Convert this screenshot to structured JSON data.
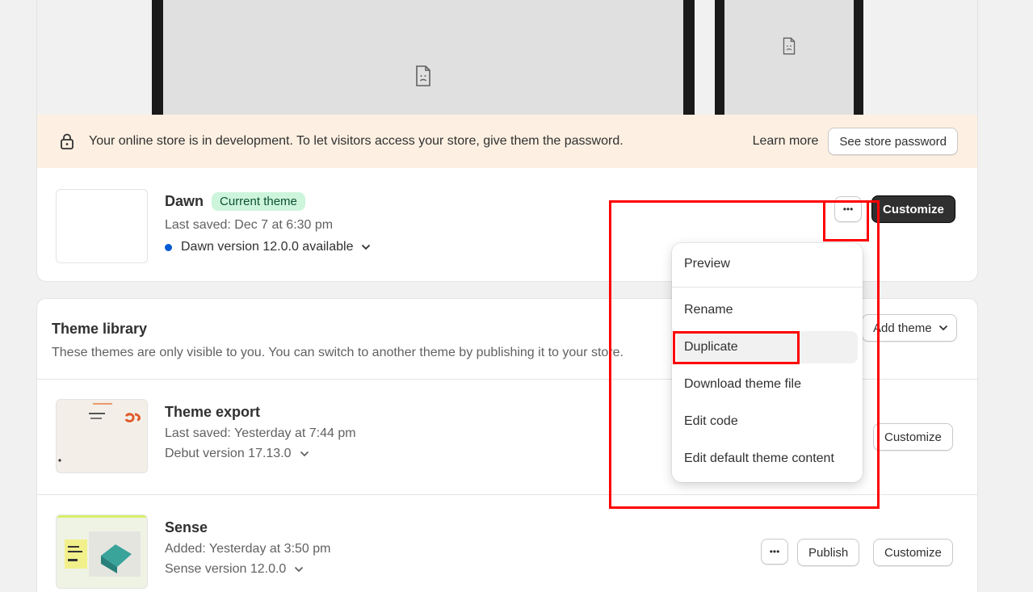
{
  "banner": {
    "message": "Your online store is in development. To let visitors access your store, give them the password.",
    "learn_more": "Learn more",
    "password_button": "See store password"
  },
  "current_theme": {
    "name": "Dawn",
    "badge": "Current theme",
    "saved": "Last saved: Dec 7 at 6:30 pm",
    "version": "Dawn version 12.0.0 available",
    "more_label": "•••",
    "customize_label": "Customize"
  },
  "library": {
    "title": "Theme library",
    "subtitle": "These themes are only visible to you. You can switch to another theme by publishing it to your store.",
    "add_theme": "Add theme",
    "themes": [
      {
        "name": "Theme export",
        "saved": "Last saved: Yesterday at 7:44 pm",
        "version": "Debut version 17.13.0",
        "customize_label": "Customize"
      },
      {
        "name": "Sense",
        "saved": "Added: Yesterday at 3:50 pm",
        "version": "Sense version 12.0.0",
        "more_label": "•••",
        "publish_label": "Publish",
        "customize_label": "Customize",
        "thumb_text": "Browse our latest products"
      }
    ]
  },
  "menu": {
    "items": [
      {
        "label": "Preview"
      },
      {
        "label": "Rename"
      },
      {
        "label": "Duplicate"
      },
      {
        "label": "Download theme file"
      },
      {
        "label": "Edit code"
      },
      {
        "label": "Edit default theme content"
      }
    ]
  },
  "colors": {
    "banner_bg": "#fdf0e2",
    "badge_bg": "#cdf5dc",
    "dark_button": "#303030",
    "annotation": "#ff0000",
    "version_dot": "#005bd3"
  }
}
